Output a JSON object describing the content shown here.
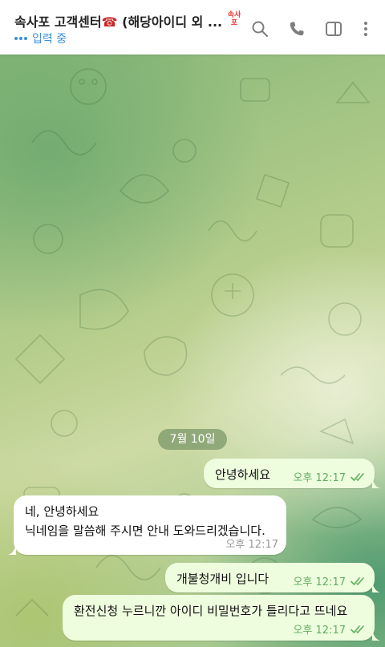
{
  "header": {
    "title_text": "속사포 고객센터",
    "title_emoji": "☎",
    "title_suffix": " (해당아이디 외 ...",
    "stamp_text": "속사포",
    "status": "입력 중"
  },
  "icons": {
    "search": "search-icon",
    "call": "phone-icon",
    "sidebar": "sidebar-toggle-icon",
    "more": "more-vertical-icon",
    "read": "double-check-icon"
  },
  "chat": {
    "date": "7월 10일",
    "messages": [
      {
        "dir": "out",
        "lines": [
          "안녕하세요"
        ],
        "time": "오후 12:17",
        "read": true
      },
      {
        "dir": "in",
        "lines": [
          "네, 안녕하세요",
          "닉네임을 말씀해 주시면 안내 도와드리겠습니다."
        ],
        "time": "오후 12:17"
      },
      {
        "dir": "out",
        "lines": [
          "개불청개비 입니다"
        ],
        "time": "오후 12:17",
        "read": true
      },
      {
        "dir": "out",
        "lines": [
          "환전신청 누르니깐 아이디 비밀번호가 틀리다고 뜨네요"
        ],
        "time": "오후 12:17",
        "read": true
      }
    ]
  },
  "colors": {
    "outgoing_bubble": "#eefdde",
    "incoming_bubble": "#ffffff",
    "accent": "#3a8fd9",
    "read_check": "#5fae60"
  }
}
